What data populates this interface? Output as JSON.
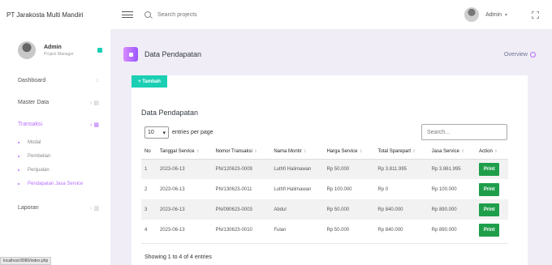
{
  "app": {
    "brand": "PT Jarakosta Multi Mandiri"
  },
  "topbar": {
    "search_placeholder": "Search projects",
    "user": "Admin"
  },
  "sidebar": {
    "profile": {
      "name": "Admin",
      "role": "Project Manager"
    },
    "items": [
      {
        "label": "Dashboard",
        "icon": "home-icon"
      },
      {
        "label": "Master Data",
        "icon": "folder-icon"
      },
      {
        "label": "Transaksi",
        "icon": "cart-icon"
      },
      {
        "label": "Laporan",
        "icon": "file-icon"
      }
    ],
    "sub_items": [
      {
        "label": "Modal"
      },
      {
        "label": "Pembelian"
      },
      {
        "label": "Penjualan"
      },
      {
        "label": "Pendapatan Jasa Service"
      }
    ]
  },
  "page": {
    "title": "Data Pendapatan",
    "overview": "Overview"
  },
  "card": {
    "add_button": "+ Tambah",
    "title": "Data Pendapatan",
    "entries_value": "10",
    "entries_label": "entries per page",
    "search_placeholder": "Search...",
    "columns": [
      "No",
      "Tanggal Service",
      "Nomor Transaksi",
      "Nama Montir",
      "Harga Service",
      "Total Sparepart",
      "Jasa Service",
      "Action"
    ],
    "rows": [
      [
        "1",
        "2023-06-13",
        "PN/120623-0009",
        "Luthfi Halimawan",
        "Rp 50.000",
        "Rp 3.811.995",
        "Rp 3.861.995"
      ],
      [
        "2",
        "2023-06-13",
        "PN/130623-0011",
        "Luthfi Halimawan",
        "Rp 100.000",
        "Rp 0",
        "Rp 100.000"
      ],
      [
        "3",
        "2023-06-13",
        "PN/090623-0003",
        "Abdul",
        "Rp 50.000",
        "Rp 840.000",
        "Rp 890.000"
      ],
      [
        "4",
        "2023-06-13",
        "PN/130623-0010",
        "Fulan",
        "Rp 50.000",
        "Rp 840.000",
        "Rp 890.000"
      ]
    ],
    "print_label": "Print",
    "footer": "Showing 1 to 4 of 4 entries"
  },
  "status_url": "localhost:8080/index.php",
  "colors": {
    "accent": "#b66dff",
    "success": "#1bcfb4",
    "print": "#1f9e4a"
  }
}
